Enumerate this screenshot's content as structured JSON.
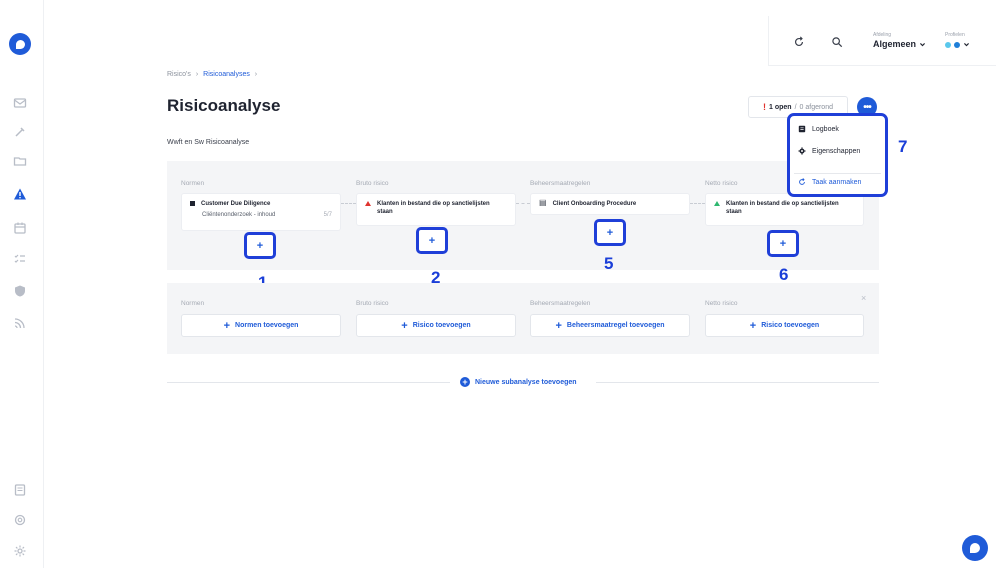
{
  "breadcrumb": {
    "root": "Risico's",
    "sep1": "›",
    "current": "Risicoanalyses",
    "sep2": "›"
  },
  "page": {
    "title": "Risicoanalyse",
    "subtitle": "Wwft en Sw Risicoanalyse"
  },
  "topbar": {
    "afdeling_label": "Afdeling",
    "afdeling_value": "Algemeen",
    "profielen_label": "Profielen",
    "colors": {
      "dot1": "#5ac8ec",
      "dot2": "#1f7fd8"
    }
  },
  "status": {
    "icon": "!",
    "open": "1 open",
    "sep": "/",
    "closed": "0 afgerond"
  },
  "more_button": "•••",
  "menu": {
    "items": [
      {
        "label": "Logboek",
        "icon": "logbook-icon"
      },
      {
        "label": "Eigenschappen",
        "icon": "gear-icon"
      },
      {
        "label": "Taak aanmaken",
        "icon": "task-refresh-icon"
      }
    ]
  },
  "analysis1": {
    "columns": [
      "Normen",
      "Bruto risico",
      "Beheersmaatregelen",
      "Netto risico"
    ],
    "cards": {
      "norm_title": "Customer Due Diligence",
      "norm_sub": "Cliëntenonderzoek - inhoud",
      "norm_count": "5/7",
      "bruto": "Klanten in bestand die op sanctielijsten staan",
      "control": "Client Onboarding Procedure",
      "netto": "Klanten in bestand die op sanctielijsten staan"
    },
    "plus": "+"
  },
  "analysis2": {
    "columns": [
      "Normen",
      "Bruto risico",
      "Beheersmaatregelen",
      "Netto risico"
    ],
    "buttons": [
      "Normen toevoegen",
      "Risico toevoegen",
      "Beheersmaatregel toevoegen",
      "Risico toevoegen"
    ],
    "plus": "+",
    "close": "×"
  },
  "new_subanalysis": "Nieuwe subanalyse toevoegen",
  "callouts": [
    "1",
    "2",
    "5",
    "6",
    "7"
  ],
  "colors": {
    "accent": "#1f5bd8",
    "callout": "#1a3ed8",
    "danger": "#e0342f",
    "success": "#2fb870"
  }
}
